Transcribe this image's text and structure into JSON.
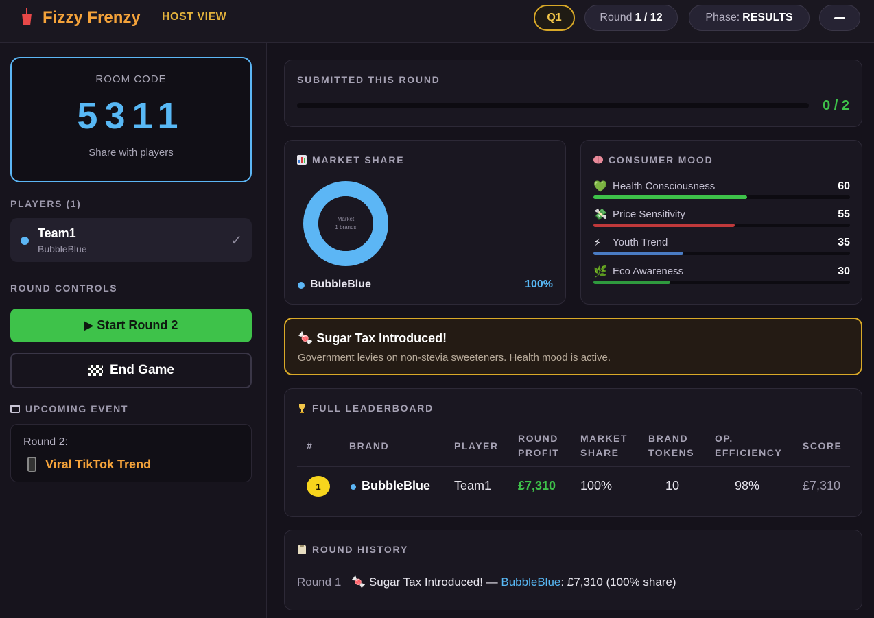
{
  "header": {
    "title": "Fizzy Frenzy",
    "mode": "HOST VIEW",
    "quarter": "Q1",
    "round_label": "Round",
    "round_value": "1 / 12",
    "phase_label": "Phase:",
    "phase_value": "RESULTS",
    "brand_color": "#f5a33a"
  },
  "sidebar": {
    "room": {
      "label": "ROOM CODE",
      "code": "5311",
      "hint": "Share with players"
    },
    "players_label": "PLAYERS (1)",
    "players": [
      {
        "name": "Team1",
        "brand": "BubbleBlue",
        "color": "#5cb6f5",
        "status_icon": "check-icon"
      }
    ],
    "controls_label": "ROUND CONTROLS",
    "start_button": "▶ Start Round 2",
    "end_button": "End Game",
    "upcoming_label": "UPCOMING EVENT",
    "upcoming": {
      "round": "Round 2:",
      "name": "Viral TikTok Trend"
    }
  },
  "submitted": {
    "title": "SUBMITTED THIS ROUND",
    "count": "0 / 2",
    "progress": 0
  },
  "market_share": {
    "title": "MARKET SHARE",
    "center_label": "Market",
    "center_sub": "1 brands",
    "legend": [
      {
        "brand": "BubbleBlue",
        "share": "100%",
        "color": "#5cb6f5"
      }
    ]
  },
  "consumer_mood": {
    "title": "CONSUMER MOOD",
    "rows": [
      {
        "label": "Health Consciousness",
        "value": "60",
        "icon": "💚",
        "color": "#3ec24a"
      },
      {
        "label": "Price Sensitivity",
        "value": "55",
        "icon": "💸",
        "color": "#c0393b"
      },
      {
        "label": "Youth Trend",
        "value": "35",
        "icon": "⚡",
        "color": "#4a7cc4"
      },
      {
        "label": "Eco Awareness",
        "value": "30",
        "icon": "🌿",
        "color": "#2f9a3e"
      }
    ]
  },
  "event": {
    "title": "Sugar Tax Introduced!",
    "description": "Government levies on non-stevia sweeteners. Health mood is active."
  },
  "leaderboard": {
    "title": "FULL LEADERBOARD",
    "columns": [
      "#",
      "BRAND",
      "PLAYER",
      "ROUND\nPROFIT",
      "MARKET\nSHARE",
      "BRAND\nTOKENS",
      "OP.\nEFFICIENCY",
      "SCORE"
    ],
    "rows": [
      {
        "rank": "1",
        "brand": "BubbleBlue",
        "player": "Team1",
        "profit": "£7,310",
        "share": "100%",
        "tokens": "10",
        "efficiency": "98%",
        "score": "£7,310"
      }
    ]
  },
  "history": {
    "title": "ROUND HISTORY",
    "rows": [
      {
        "round": "Round 1",
        "event": "Sugar Tax Introduced! —",
        "brand": "BubbleBlue",
        "detail": ": £7,310 (100% share)"
      }
    ]
  }
}
